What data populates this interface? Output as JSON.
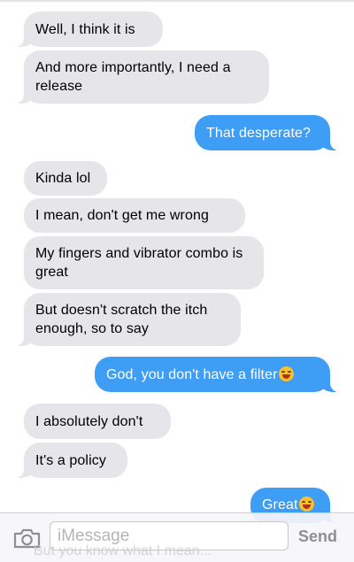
{
  "conversation": {
    "messages": [
      {
        "direction": "in",
        "text": "Well, I think it is"
      },
      {
        "direction": "in",
        "text": "And more importantly, I need a release"
      },
      {
        "direction": "out",
        "text": "That desperate?"
      },
      {
        "direction": "in",
        "text": "Kinda lol"
      },
      {
        "direction": "in",
        "text": "I mean, don't get me wrong"
      },
      {
        "direction": "in",
        "text": "My fingers and vibrator combo is great"
      },
      {
        "direction": "in",
        "text": "But doesn't scratch the itch enough, so to say"
      },
      {
        "direction": "out",
        "text": "God, you don't have a filter",
        "emoji": "rolling-on-floor-laughing"
      },
      {
        "direction": "in",
        "text": "I absolutely don't"
      },
      {
        "direction": "in",
        "text": "It's a policy"
      },
      {
        "direction": "out",
        "text": "Great",
        "emoji": "rolling-on-floor-laughing"
      }
    ],
    "partially_hidden_message": "But you know what I mean..."
  },
  "composer": {
    "placeholder": "iMessage",
    "send_label": "Send",
    "camera_icon": "camera-icon"
  },
  "colors": {
    "incoming_bubble": "#e5e5ea",
    "outgoing_bubble": "#3e9df5",
    "send_disabled": "#8e8e93"
  }
}
